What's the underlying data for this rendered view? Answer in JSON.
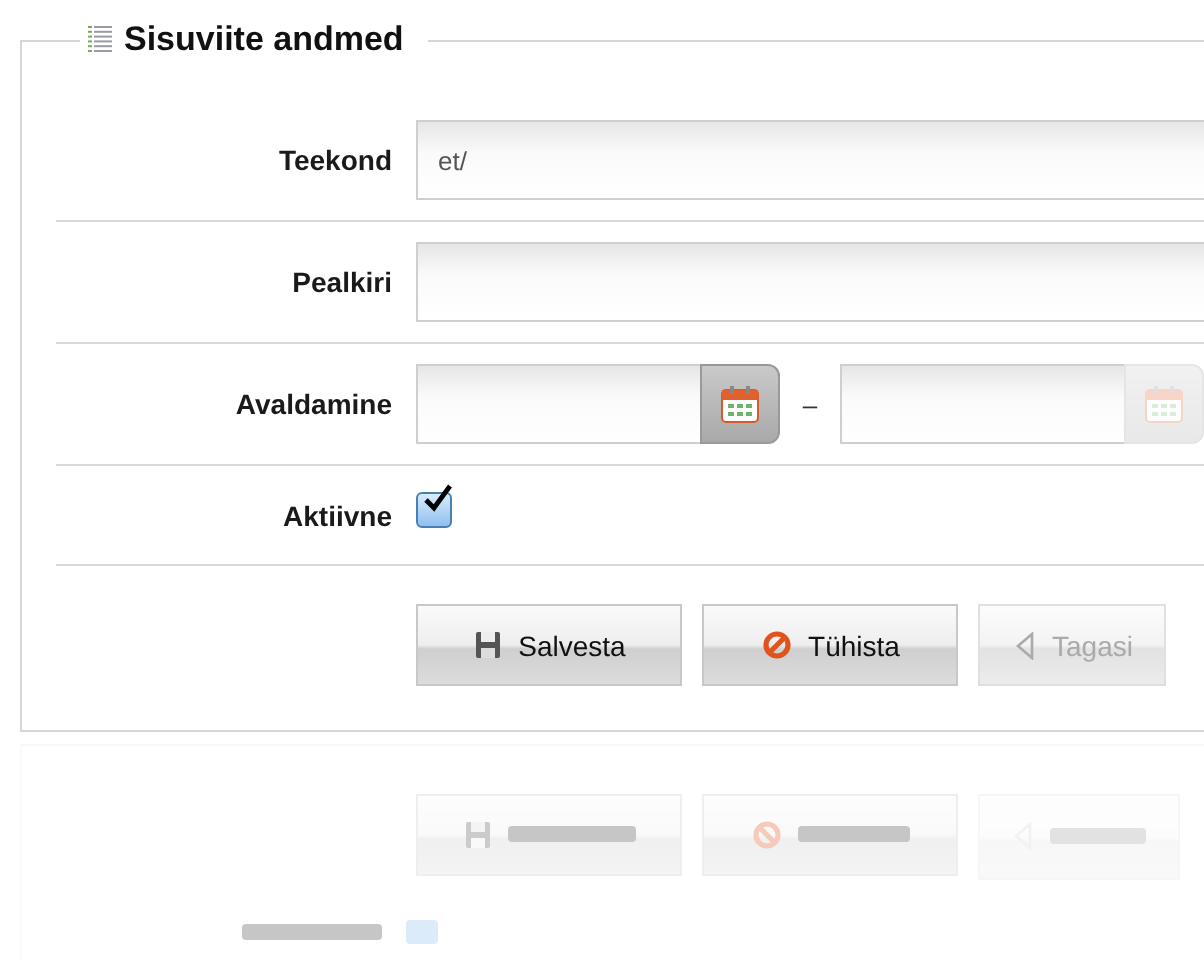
{
  "section": {
    "title": "Sisuviite andmed"
  },
  "fields": [
    {
      "kind": "text",
      "label": "Teekond",
      "value": "et/"
    },
    {
      "kind": "text",
      "label": "Pealkiri"
    },
    {
      "kind": "daterange",
      "label": "Avaldamine",
      "separator": "–"
    },
    {
      "kind": "checkbox",
      "label": "Aktiivne",
      "checked": true
    }
  ],
  "buttons": [
    {
      "kind": "save",
      "label": "Salvesta",
      "disabled": false
    },
    {
      "kind": "cancel",
      "label": "Tühista",
      "disabled": false
    },
    {
      "kind": "back",
      "label": "Tagasi",
      "disabled": true
    }
  ]
}
